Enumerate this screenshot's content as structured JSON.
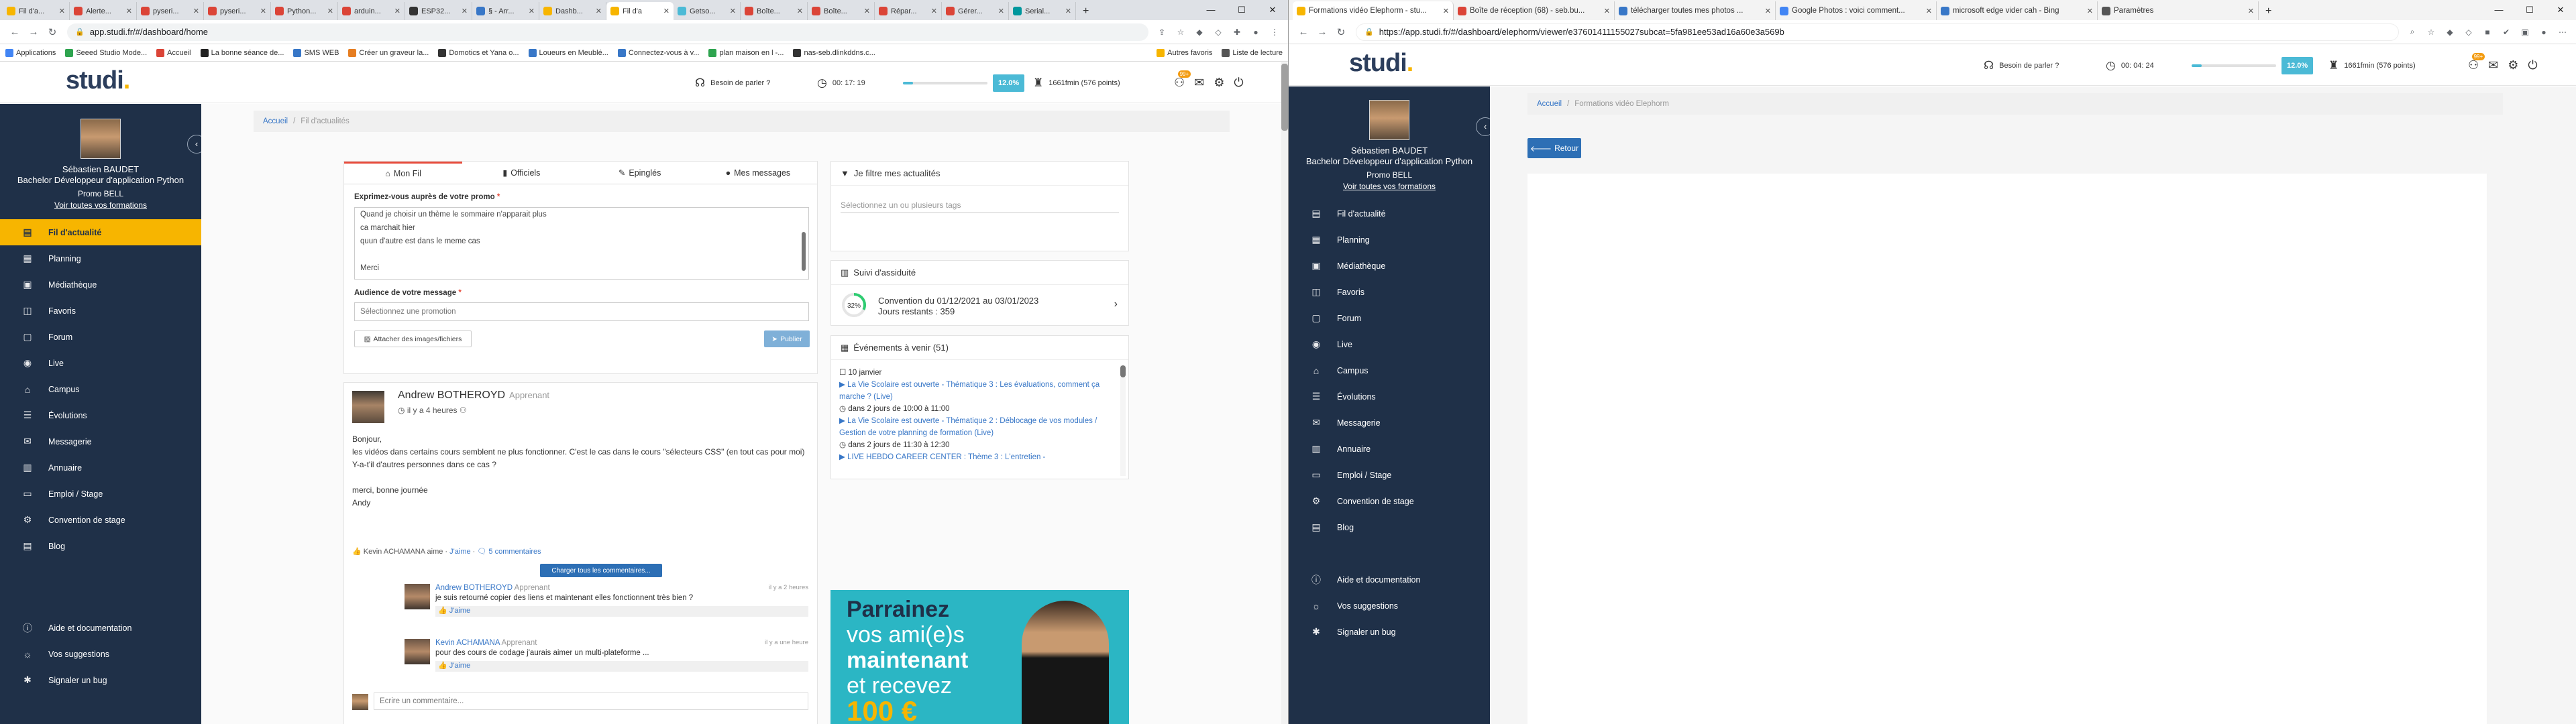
{
  "left_window": {
    "tabs": [
      {
        "label": "Fil d'a...",
        "color": "#f7b500"
      },
      {
        "label": "Alerte...",
        "color": "#db4437"
      },
      {
        "label": "pyseri...",
        "color": "#db4437"
      },
      {
        "label": "pyseri...",
        "color": "#db4437"
      },
      {
        "label": "Python...",
        "color": "#db4437"
      },
      {
        "label": "arduin...",
        "color": "#db4437"
      },
      {
        "label": "ESP32...",
        "color": "#333333"
      },
      {
        "label": "§ - Arr...",
        "color": "#3877c7"
      },
      {
        "label": "Dashb...",
        "color": "#f7b500"
      },
      {
        "label": "Fil d'a",
        "color": "#f7b500",
        "active": true
      },
      {
        "label": "Getso...",
        "color": "#4bbad6"
      },
      {
        "label": "Boîte...",
        "color": "#db4437"
      },
      {
        "label": "Boîte...",
        "color": "#db4437"
      },
      {
        "label": "Répar...",
        "color": "#db4437"
      },
      {
        "label": "Gérer...",
        "color": "#db4437"
      },
      {
        "label": "Serial...",
        "color": "#00979d"
      }
    ],
    "url": "app.studi.fr/#/dashboard/home",
    "bookmarks": [
      {
        "label": "Applications",
        "color": "#4285f4"
      },
      {
        "label": "Seeed Studio Mode...",
        "color": "#2ea44f"
      },
      {
        "label": "Accueil",
        "color": "#db4437"
      },
      {
        "label": "La bonne séance de...",
        "color": "#222222"
      },
      {
        "label": "SMS WEB",
        "color": "#3877c7"
      },
      {
        "label": "Créer un graveur la...",
        "color": "#e67e22"
      },
      {
        "label": "Domotics et Yana o...",
        "color": "#333333"
      },
      {
        "label": "Loueurs en Meublé...",
        "color": "#3877c7"
      },
      {
        "label": "Connectez-vous à v...",
        "color": "#3877c7"
      },
      {
        "label": "plan maison en l -...",
        "color": "#2ea44f"
      },
      {
        "label": "nas-seb.dlinkddns.c...",
        "color": "#333333"
      }
    ],
    "bookmarks_right": [
      {
        "label": "Autres favoris",
        "color": "#f7b500"
      },
      {
        "label": "Liste de lecture",
        "color": "#555555"
      }
    ]
  },
  "right_window": {
    "tabs": [
      {
        "label": "Formations vidéo Elephorm - stu...",
        "color": "#f7b500",
        "active": true
      },
      {
        "label": "Boîte de réception (68) - seb.bu...",
        "color": "#db4437"
      },
      {
        "label": "télécharger toutes mes photos ...",
        "color": "#3877c7"
      },
      {
        "label": "Google Photos : voici comment...",
        "color": "#4285f4"
      },
      {
        "label": "microsoft edge vider cah - Bing",
        "color": "#3877c7"
      },
      {
        "label": "Paramètres",
        "color": "#555555"
      }
    ],
    "url": "https://app.studi.fr/#/dashboard/elephorm/viewer/e37601411155027subcat=5fa981ee53ad16a60e3a569b",
    "breadcrumb": {
      "home": "Accueil",
      "current": "Formations vidéo Elephorm"
    },
    "back_label": "Retour",
    "timer": "00: 04: 24",
    "points": "1661fmin (576 points)"
  },
  "app": {
    "logo": "studi",
    "help": "Besoin de parler ?",
    "timer": "00: 17: 19",
    "progress_fraction": 0.12,
    "progress_label": "12.0%",
    "points": "1661fmin (576 points)",
    "notif_count": "99+"
  },
  "profile": {
    "name": "Sébastien BAUDET",
    "program": "Bachelor Développeur d'application Python",
    "promo": "Promo BELL",
    "link": "Voir toutes vos formations"
  },
  "nav": [
    {
      "label": "Fil d'actualité",
      "icon": "news-icon",
      "glyph": "▤",
      "active": true
    },
    {
      "label": "Planning",
      "icon": "calendar-icon",
      "glyph": "▦"
    },
    {
      "label": "Médiathèque",
      "icon": "media-icon",
      "glyph": "▣"
    },
    {
      "label": "Favoris",
      "icon": "bookmark-icon",
      "glyph": "◫"
    },
    {
      "label": "Forum",
      "icon": "forum-icon",
      "glyph": "▢"
    },
    {
      "label": "Live",
      "icon": "live-icon",
      "glyph": "◉"
    },
    {
      "label": "Campus",
      "icon": "campus-icon",
      "glyph": "⌂"
    },
    {
      "label": "Évolutions",
      "icon": "evolutions-icon",
      "glyph": "☰"
    },
    {
      "label": "Messagerie",
      "icon": "mail-icon",
      "glyph": "✉"
    },
    {
      "label": "Annuaire",
      "icon": "directory-icon",
      "glyph": "▥"
    },
    {
      "label": "Emploi / Stage",
      "icon": "briefcase-icon",
      "glyph": "▭"
    },
    {
      "label": "Convention de stage",
      "icon": "contract-icon",
      "glyph": "⚙"
    },
    {
      "label": "Blog",
      "icon": "blog-icon",
      "glyph": "▤"
    }
  ],
  "nav_bottom": [
    {
      "label": "Aide et documentation",
      "icon": "help-icon",
      "glyph": "ⓘ"
    },
    {
      "label": "Vos suggestions",
      "icon": "suggestion-icon",
      "glyph": "☼"
    },
    {
      "label": "Signaler un bug",
      "icon": "bug-icon",
      "glyph": "✱"
    }
  ],
  "breadcrumb": {
    "home": "Accueil",
    "current": "Fil d'actualités"
  },
  "feed": {
    "tabs": [
      "Mon Fil",
      "Officiels",
      "Epinglés",
      "Mes messages"
    ],
    "compose_label": "Exprimez-vous auprès de votre promo",
    "compose_lines": [
      "Quand je choisir un thème le sommaire n'apparait plus",
      "ca marchait hier",
      "quun d'autre est dans le meme cas",
      "",
      "Merci"
    ],
    "audience_label": "Audience de votre message",
    "audience_placeholder": "Sélectionnez une promotion",
    "attach_label": "Attacher des images/fichiers",
    "publish_label": "Publier",
    "post": {
      "author": "Andrew BOTHEROYD",
      "role": "Apprenant",
      "time": "il y a 4 heures",
      "body": [
        "Bonjour,",
        "les vidéos dans certains cours semblent ne plus fonctionner. C'est le cas dans le cours \"sélecteurs CSS\" (en tout cas pour moi)",
        "Y-a-t'il d'autres personnes dans ce cas ?",
        "",
        "merci, bonne journée",
        "Andy"
      ],
      "likes": "Kevin ACHAMANA aime",
      "like_action": "J'aime",
      "comments_count": "5 commentaires",
      "load_comments": "Charger tous les commentaires...",
      "comments": [
        {
          "author": "Andrew BOTHEROYD",
          "role": "Apprenant",
          "time": "il y a 2 heures",
          "text": "je suis retourné copier des liens et maintenant elles fonctionnent très bien ?",
          "like": "J'aime"
        },
        {
          "author": "Kevin ACHAMANA",
          "role": "Apprenant",
          "time": "il y a une heure",
          "text": "pour des cours de codage j'aurais aimer un multi-plateforme ...",
          "like": "J'aime"
        }
      ],
      "comment_placeholder": "Ecrire un commentaire..."
    }
  },
  "right_col": {
    "filter_title": "Je filtre mes actualités",
    "filter_placeholder": "Sélectionnez un ou plusieurs tags",
    "assiduity_title": "Suivi d'assiduité",
    "assiduity_pct": "32%",
    "assiduity_fraction": 0.32,
    "convention": "Convention du 01/12/2021 au 03/01/2023",
    "days_left": "Jours restants : 359",
    "events_title": "Événements à venir (51)",
    "events_date": "10 janvier",
    "events": [
      {
        "title": "La Vie Scolaire est ouverte - Thématique 3 : Les évaluations, comment ça marche ? (Live)",
        "when": "dans 2 jours de 10:00 à 11:00"
      },
      {
        "title": "La Vie Scolaire est ouverte - Thématique 2 : Déblocage de vos modules / Gestion de votre planning de formation (Live)",
        "when": "dans 2 jours de 11:30 à 12:30"
      },
      {
        "title": "LIVE HEBDO CAREER CENTER : Thème 3 : L'entretien -",
        "when": ""
      }
    ],
    "promo": {
      "line1": "Parrainez",
      "line2": "vos ami(e)s",
      "line3": "maintenant",
      "line4": "et recevez",
      "amount": "100 €"
    }
  }
}
